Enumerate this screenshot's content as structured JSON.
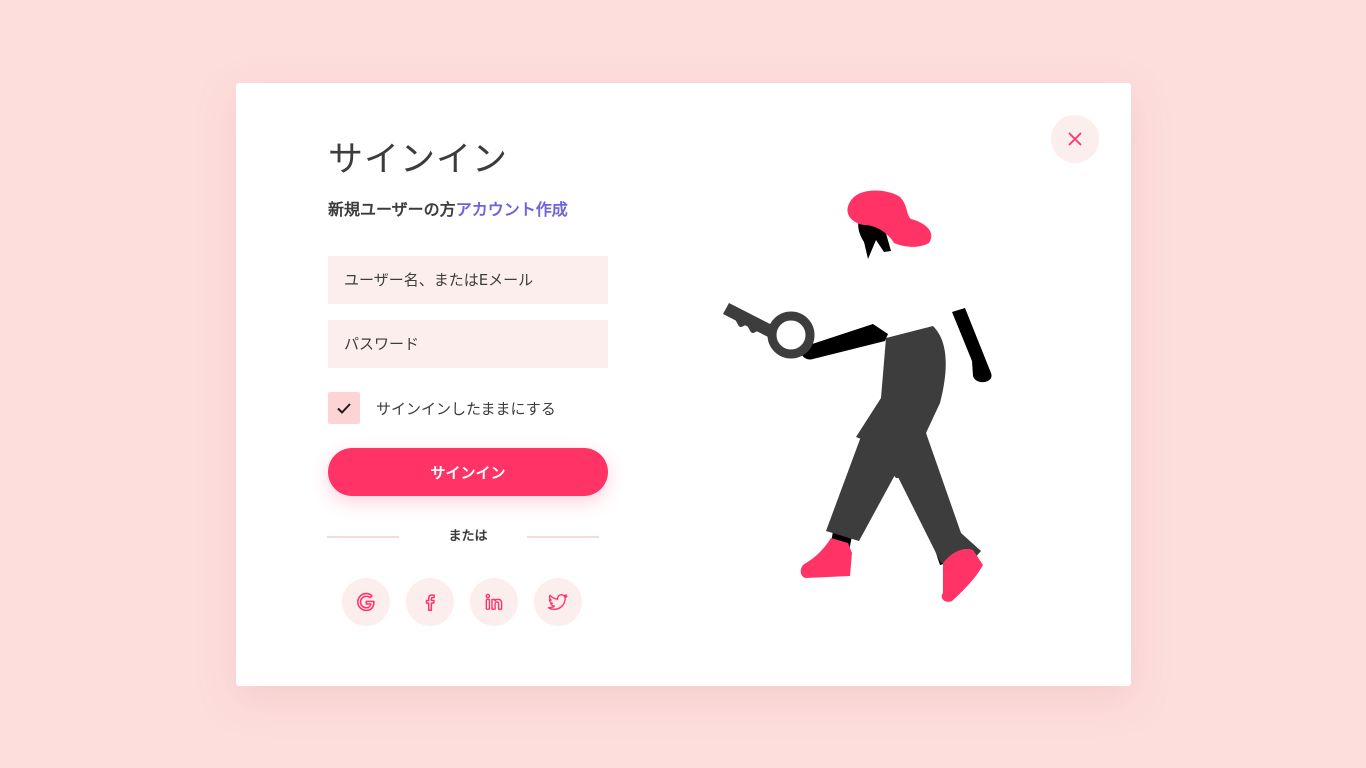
{
  "dialog": {
    "title": "サインイン",
    "new_user_prompt": "新規ユーザーの方",
    "create_account_link": "アカウント作成",
    "username_placeholder": "ユーザー名、またはEメール",
    "password_placeholder": "パスワード",
    "remember_me_label": "サインインしたままにする",
    "remember_me_checked": true,
    "signin_button_label": "サインイン",
    "divider_text": "または"
  },
  "social_buttons": [
    {
      "icon": "google-icon"
    },
    {
      "icon": "facebook-icon"
    },
    {
      "icon": "linkedin-icon"
    },
    {
      "icon": "twitter-icon"
    }
  ],
  "colors": {
    "background": "#fddedd",
    "card": "#ffffff",
    "accent": "#ff3366",
    "link": "#6e63d9",
    "input_background": "#fdeeee",
    "text": "#3c3c3c",
    "illustration_dark": "#3d3d3d"
  },
  "icons": {
    "close": "close-icon",
    "checkbox_mark": "checkmark-icon",
    "illustration": "person-with-key-illustration"
  }
}
